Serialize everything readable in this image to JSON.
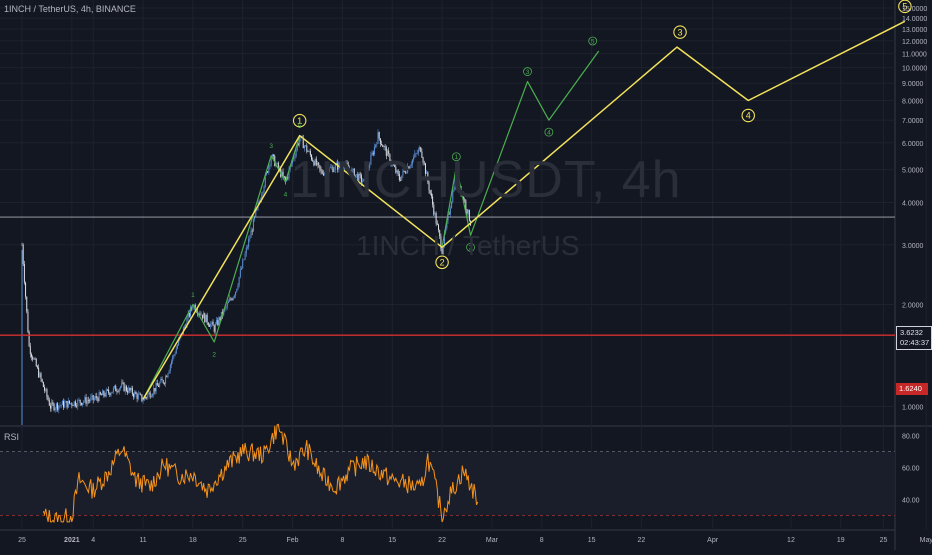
{
  "header": {
    "symbol": "1INCH / TetherUS, 4h, BINANCE"
  },
  "watermark": {
    "line1": "1INCHUSDT, 4h",
    "line2": "1INCH / TetherUS"
  },
  "indicator": {
    "label": "RSI"
  },
  "price_tags": {
    "current_price": "3.6232",
    "countdown": "02:43:37",
    "level_price": "1.6240"
  },
  "colors": {
    "background": "#131722",
    "grid": "#1e222d",
    "candle_up": "#5b8fd6",
    "candle_down": "#dde0e6",
    "primary_wave": "#f2e15b",
    "secondary_wave": "#4caf50",
    "rsi_line": "#f7931a",
    "support_line": "#d32f2f",
    "current_price_line": "#cfd2da"
  },
  "chart_data": [
    {
      "type": "line",
      "title": "",
      "y_scale": "log",
      "ylim": [
        0.8,
        15.5
      ],
      "y_ticks": [
        "15.0000",
        "14.0000",
        "13.0000",
        "12.0000",
        "11.0000",
        "10.0000",
        "9.0000",
        "8.0000",
        "7.0000",
        "6.0000",
        "5.0000",
        "4.0000",
        "3.0000",
        "2.0000",
        "1.0000"
      ],
      "x_tick_labels": [
        "25",
        "2021",
        "4",
        "11",
        "18",
        "25",
        "Feb",
        "8",
        "15",
        "22",
        "Mar",
        "8",
        "15",
        "22",
        "Apr",
        "12",
        "19",
        "25",
        "May"
      ],
      "current_price": 3.6232,
      "support_level": 1.624,
      "price_path": [
        {
          "x": "2020-12-25",
          "y": 3.0
        },
        {
          "x": "2020-12-26",
          "y": 1.5
        },
        {
          "x": "2020-12-29",
          "y": 1.0
        },
        {
          "x": "2021-01-04",
          "y": 1.05
        },
        {
          "x": "2021-01-08",
          "y": 1.15
        },
        {
          "x": "2021-01-11",
          "y": 1.05
        },
        {
          "x": "2021-01-14",
          "y": 1.2
        },
        {
          "x": "2021-01-18",
          "y": 2.0
        },
        {
          "x": "2021-01-21",
          "y": 1.7
        },
        {
          "x": "2021-01-24",
          "y": 2.2
        },
        {
          "x": "2021-01-27",
          "y": 3.8
        },
        {
          "x": "2021-01-29",
          "y": 5.5
        },
        {
          "x": "2021-01-31",
          "y": 4.6
        },
        {
          "x": "2021-02-02",
          "y": 6.2
        },
        {
          "x": "2021-02-05",
          "y": 4.9
        },
        {
          "x": "2021-02-08",
          "y": 5.2
        },
        {
          "x": "2021-02-11",
          "y": 4.6
        },
        {
          "x": "2021-02-13",
          "y": 6.3
        },
        {
          "x": "2021-02-16",
          "y": 4.7
        },
        {
          "x": "2021-02-19",
          "y": 5.8
        },
        {
          "x": "2021-02-22",
          "y": 2.9
        },
        {
          "x": "2021-02-24",
          "y": 4.9
        },
        {
          "x": "2021-02-26",
          "y": 3.5
        }
      ],
      "primary_wave": {
        "labels": [
          "1",
          "2",
          "3",
          "4",
          "5"
        ],
        "points": [
          {
            "x": "2021-01-11",
            "y": 1.05,
            "label": ""
          },
          {
            "x": "2021-02-02",
            "y": 6.3,
            "label": "1"
          },
          {
            "x": "2021-02-22",
            "y": 2.95,
            "label": "2"
          },
          {
            "x": "2021-03-27",
            "y": 11.5,
            "label": "3"
          },
          {
            "x": "2021-04-06",
            "y": 8.0,
            "label": "4"
          },
          {
            "x": "2021-04-28",
            "y": 13.7,
            "label": "5"
          }
        ]
      },
      "secondary_wave": {
        "labels": [
          "1",
          "2",
          "3",
          "4",
          "5",
          "1",
          "2",
          "3",
          "4",
          "5"
        ],
        "points": [
          {
            "x": "2021-01-11",
            "y": 1.05,
            "label": ""
          },
          {
            "x": "2021-01-18",
            "y": 2.0,
            "label": "1"
          },
          {
            "x": "2021-01-21",
            "y": 1.55,
            "label": "2"
          },
          {
            "x": "2021-01-29",
            "y": 5.5,
            "label": "3"
          },
          {
            "x": "2021-01-31",
            "y": 4.6,
            "label": "4"
          },
          {
            "x": "2021-02-02",
            "y": 6.3,
            "label": "5"
          },
          {
            "x": "2021-02-22",
            "y": 2.95,
            "label": ""
          },
          {
            "x": "2021-02-24",
            "y": 5.1,
            "label": "1"
          },
          {
            "x": "2021-02-26",
            "y": 3.2,
            "label": "2"
          },
          {
            "x": "2021-03-06",
            "y": 9.1,
            "label": "3"
          },
          {
            "x": "2021-03-09",
            "y": 7.0,
            "label": "4"
          },
          {
            "x": "2021-03-16",
            "y": 11.2,
            "label": "5"
          }
        ]
      }
    },
    {
      "type": "line",
      "title": "RSI",
      "ylim": [
        25,
        88
      ],
      "y_ticks": [
        "80.00",
        "60.00",
        "40.00"
      ],
      "upper_band": 70,
      "lower_band": 30,
      "series": [
        {
          "values": [
            {
              "x": "2020-12-28",
              "y": 30
            },
            {
              "x": "2020-12-30",
              "y": 27
            },
            {
              "x": "2021-01-01",
              "y": 30
            },
            {
              "x": "2021-01-02",
              "y": 52
            },
            {
              "x": "2021-01-04",
              "y": 46
            },
            {
              "x": "2021-01-06",
              "y": 56
            },
            {
              "x": "2021-01-08",
              "y": 72
            },
            {
              "x": "2021-01-10",
              "y": 52
            },
            {
              "x": "2021-01-12",
              "y": 48
            },
            {
              "x": "2021-01-14",
              "y": 62
            },
            {
              "x": "2021-01-16",
              "y": 55
            },
            {
              "x": "2021-01-18",
              "y": 56
            },
            {
              "x": "2021-01-20",
              "y": 46
            },
            {
              "x": "2021-01-23",
              "y": 62
            },
            {
              "x": "2021-01-25",
              "y": 70
            },
            {
              "x": "2021-01-28",
              "y": 68
            },
            {
              "x": "2021-01-30",
              "y": 86
            },
            {
              "x": "2021-02-01",
              "y": 62
            },
            {
              "x": "2021-02-03",
              "y": 72
            },
            {
              "x": "2021-02-05",
              "y": 55
            },
            {
              "x": "2021-02-07",
              "y": 48
            },
            {
              "x": "2021-02-09",
              "y": 58
            },
            {
              "x": "2021-02-11",
              "y": 64
            },
            {
              "x": "2021-02-13",
              "y": 58
            },
            {
              "x": "2021-02-15",
              "y": 52
            },
            {
              "x": "2021-02-17",
              "y": 50
            },
            {
              "x": "2021-02-19",
              "y": 46
            },
            {
              "x": "2021-02-20",
              "y": 66
            },
            {
              "x": "2021-02-21",
              "y": 50
            },
            {
              "x": "2021-02-22",
              "y": 30
            },
            {
              "x": "2021-02-23",
              "y": 42
            },
            {
              "x": "2021-02-25",
              "y": 58
            },
            {
              "x": "2021-02-27",
              "y": 40
            }
          ]
        }
      ]
    }
  ]
}
